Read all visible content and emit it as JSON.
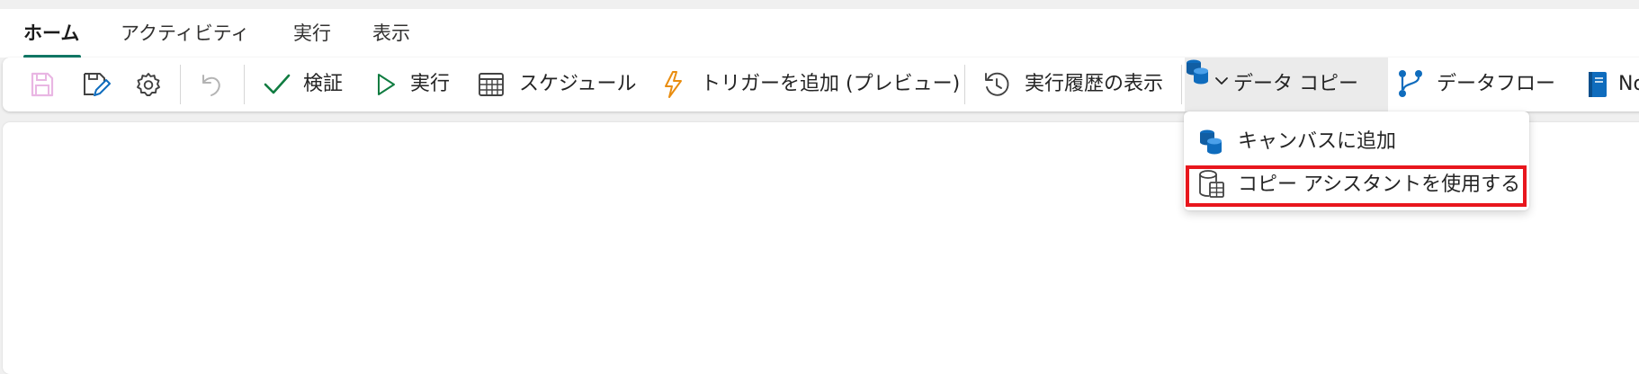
{
  "tabs": [
    {
      "label": "ホーム",
      "active": true
    },
    {
      "label": "アクティビティ",
      "active": false
    },
    {
      "label": "実行",
      "active": false
    },
    {
      "label": "表示",
      "active": false
    }
  ],
  "toolbar": {
    "validate_label": "検証",
    "run_label": "実行",
    "schedule_label": "スケジュール",
    "trigger_label": "トリガーを追加 (プレビュー)",
    "run_history_label": "実行履歴の表示",
    "copy_data_label": "データ コピー",
    "dataflow_label": "データフロー",
    "notebook_label": "Notebook"
  },
  "icons": {
    "save": "save-icon",
    "save_as": "save-edit-icon",
    "settings": "gear-icon",
    "undo": "undo-icon",
    "validate": "checkmark-icon",
    "run": "play-icon",
    "schedule": "calendar-icon",
    "trigger": "lightning-icon",
    "history": "history-icon",
    "copy_data": "database-copy-icon",
    "dataflow": "dataflow-icon",
    "notebook": "notebook-icon"
  },
  "copy_menu": {
    "items": [
      {
        "label": "キャンバスに追加",
        "icon": "database-copy-icon"
      },
      {
        "label": "コピー アシスタントを使用する",
        "icon": "copy-assistant-icon",
        "highlighted": true
      }
    ]
  },
  "colors": {
    "accent": "#117865",
    "highlight": "#e8161d",
    "validate_green": "#107c41",
    "trigger_orange": "#e98d10",
    "db_blue": "#0f6cbd"
  }
}
